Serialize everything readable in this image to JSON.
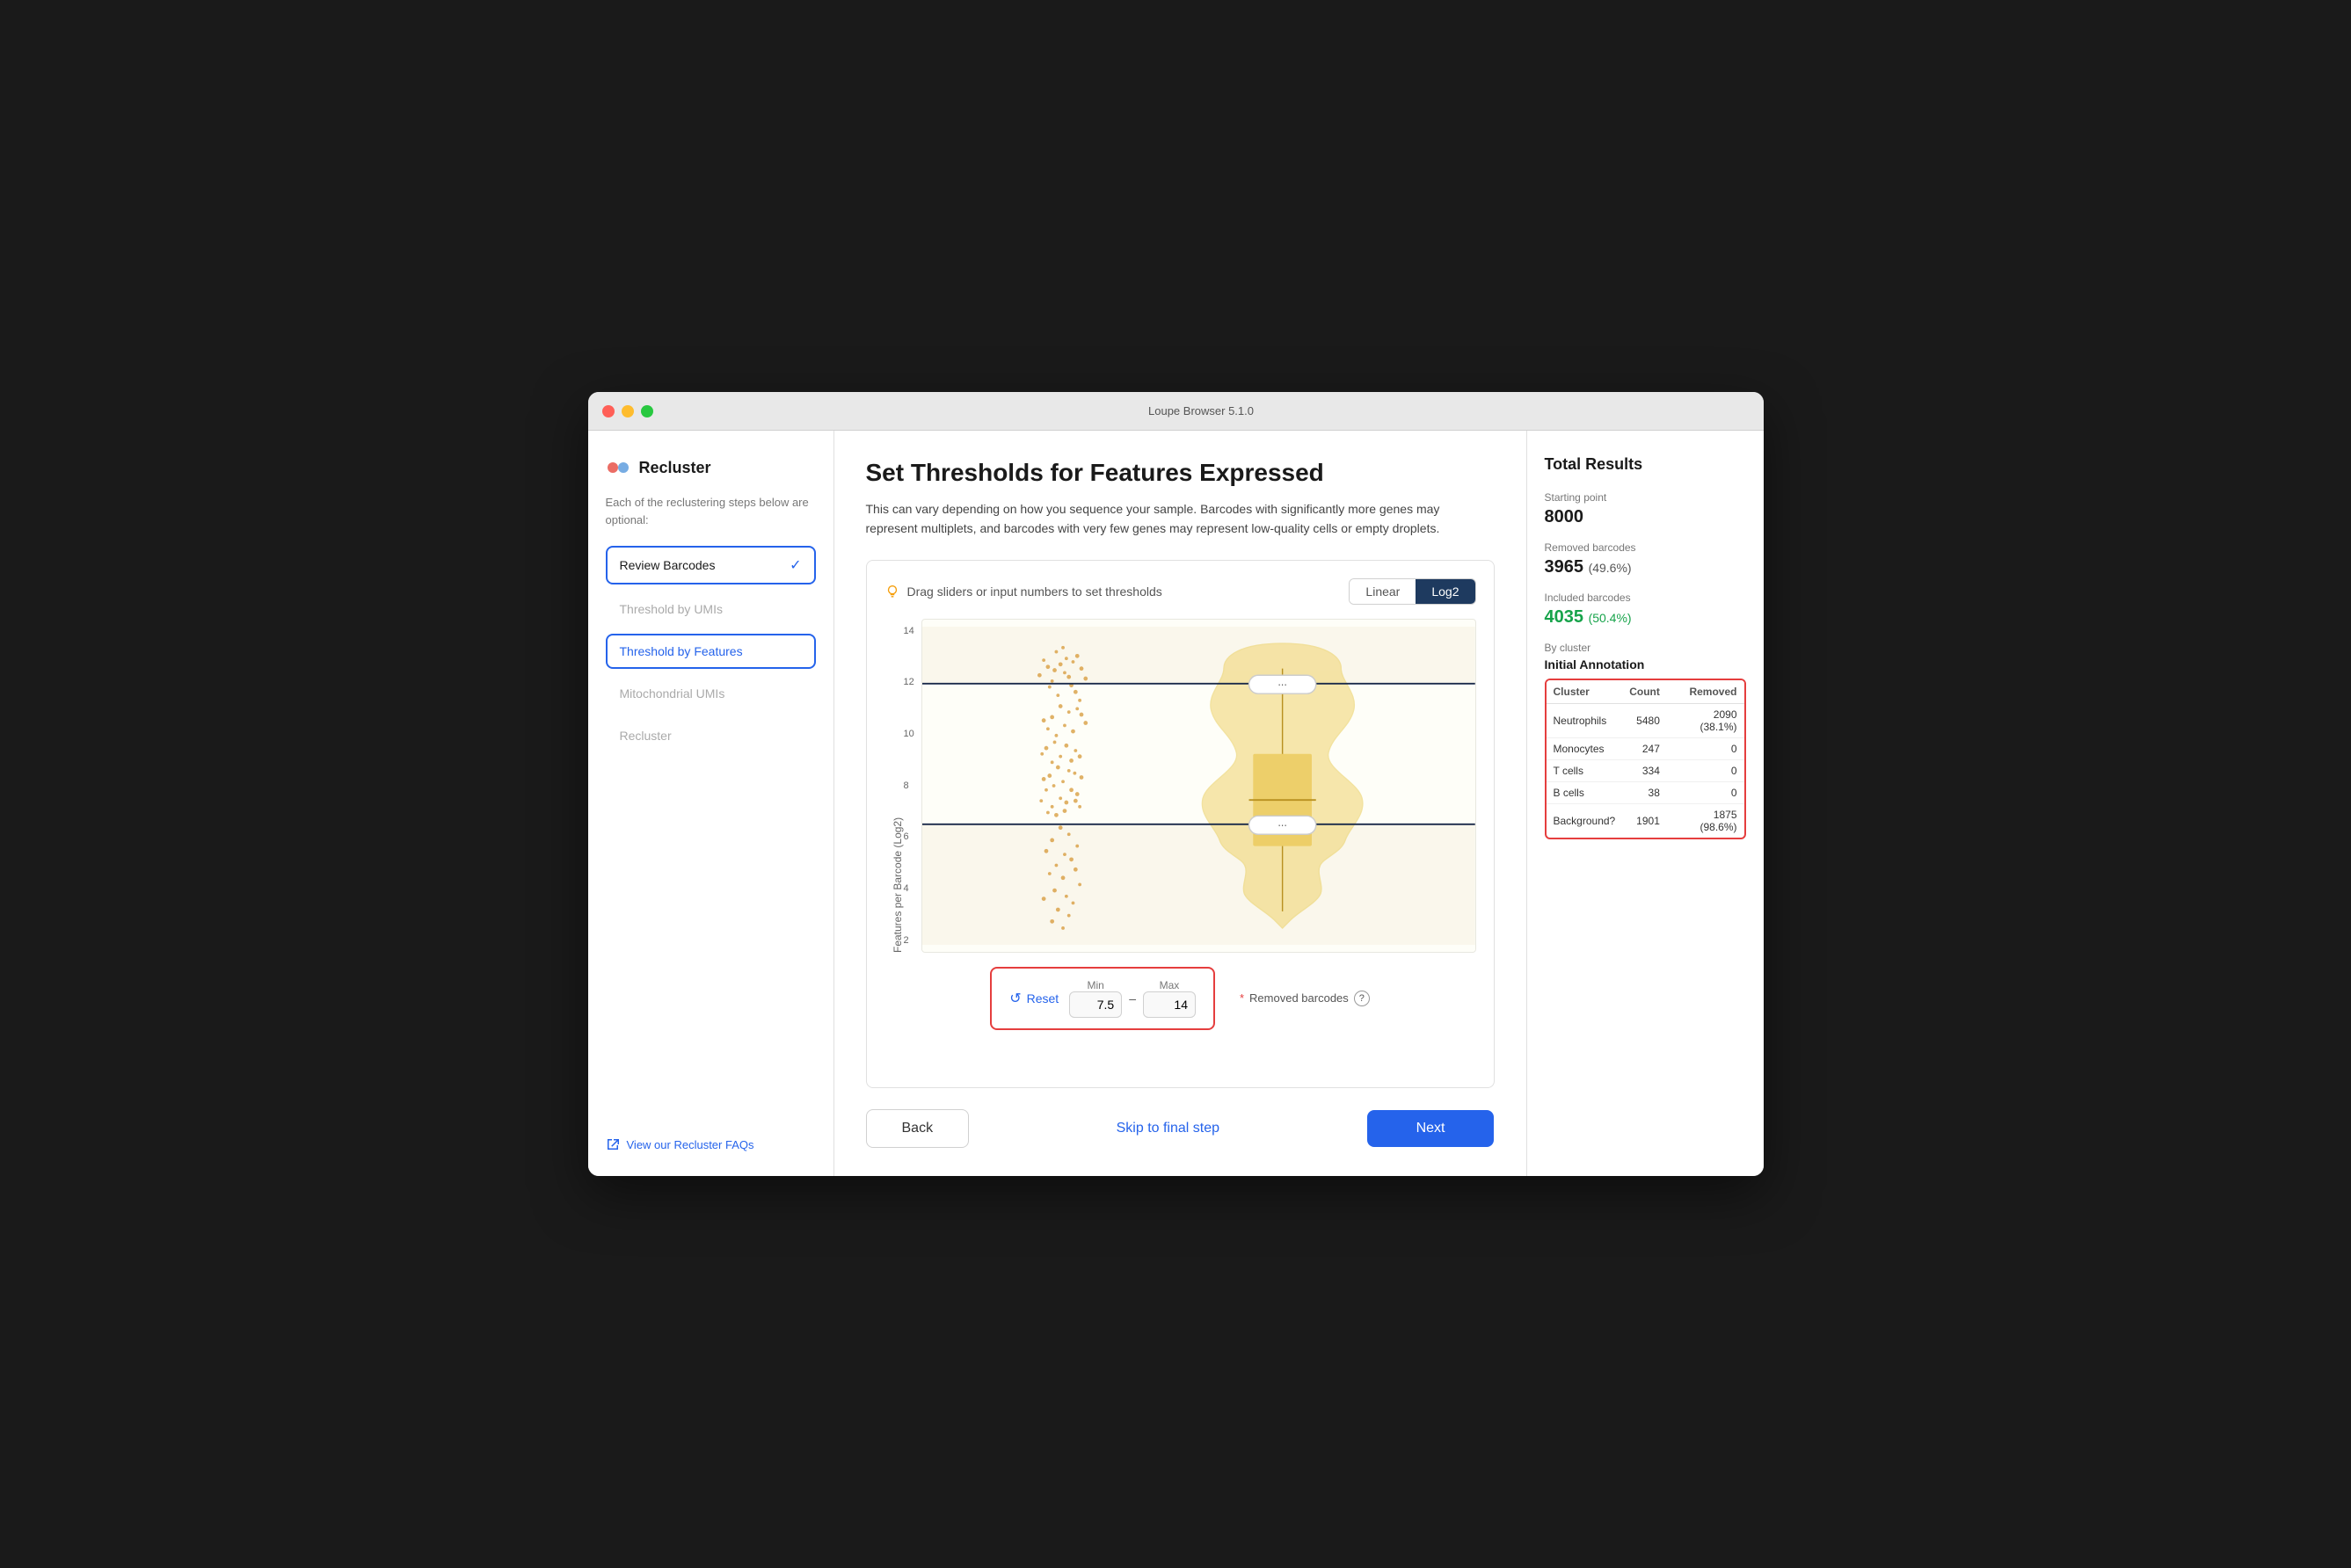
{
  "titlebar": {
    "title": "Loupe Browser 5.1.0",
    "buttons": [
      "close",
      "minimize",
      "maximize"
    ]
  },
  "sidebar": {
    "logo_text": "Recluster",
    "description": "Each of the reclustering steps below are optional:",
    "steps": [
      {
        "id": "review-barcodes",
        "label": "Review Barcodes",
        "state": "completed"
      },
      {
        "id": "threshold-umis",
        "label": "Threshold by UMIs",
        "state": "inactive"
      },
      {
        "id": "threshold-features",
        "label": "Threshold by Features",
        "state": "active"
      },
      {
        "id": "mitochondrial-umis",
        "label": "Mitochondrial UMIs",
        "state": "inactive"
      },
      {
        "id": "recluster",
        "label": "Recluster",
        "state": "inactive"
      }
    ],
    "faq_label": "View our Recluster FAQs"
  },
  "main": {
    "title": "Set Thresholds for Features Expressed",
    "description": "This can vary depending on how you sequence your sample. Barcodes with significantly more genes may represent multiplets, and barcodes with very few genes may represent low-quality cells or empty droplets.",
    "chart_hint": "Drag sliders or input numbers to set thresholds",
    "scale_buttons": [
      {
        "label": "Linear",
        "active": false
      },
      {
        "label": "Log2",
        "active": true
      }
    ],
    "y_axis_label": "Features per Barcode (Log2)",
    "y_axis_ticks": [
      "14",
      "12",
      "10",
      "8",
      "6",
      "4",
      "2"
    ],
    "threshold_min": "7.5",
    "threshold_max": "14",
    "reset_label": "Reset",
    "min_label": "Min",
    "max_label": "Max",
    "removed_label": "Removed barcodes",
    "buttons": {
      "back": "Back",
      "skip": "Skip to final step",
      "next": "Next"
    }
  },
  "right_panel": {
    "title": "Total Results",
    "starting_point_label": "Starting point",
    "starting_point_value": "8000",
    "removed_barcodes_label": "Removed barcodes",
    "removed_barcodes_value": "3965",
    "removed_barcodes_pct": "(49.6%)",
    "included_barcodes_label": "Included barcodes",
    "included_barcodes_value": "4035",
    "included_barcodes_pct": "(50.4%)",
    "by_cluster_label": "By cluster",
    "annotation_title": "Initial Annotation",
    "cluster_headers": [
      "Cluster",
      "Count",
      "Removed"
    ],
    "clusters": [
      {
        "name": "Neutrophils",
        "count": "5480",
        "removed": "2090 (38.1%)"
      },
      {
        "name": "Monocytes",
        "count": "247",
        "removed": "0"
      },
      {
        "name": "T cells",
        "count": "334",
        "removed": "0"
      },
      {
        "name": "B cells",
        "count": "38",
        "removed": "0"
      },
      {
        "name": "Background?",
        "count": "1901",
        "removed": "1875 (98.6%)"
      }
    ]
  }
}
